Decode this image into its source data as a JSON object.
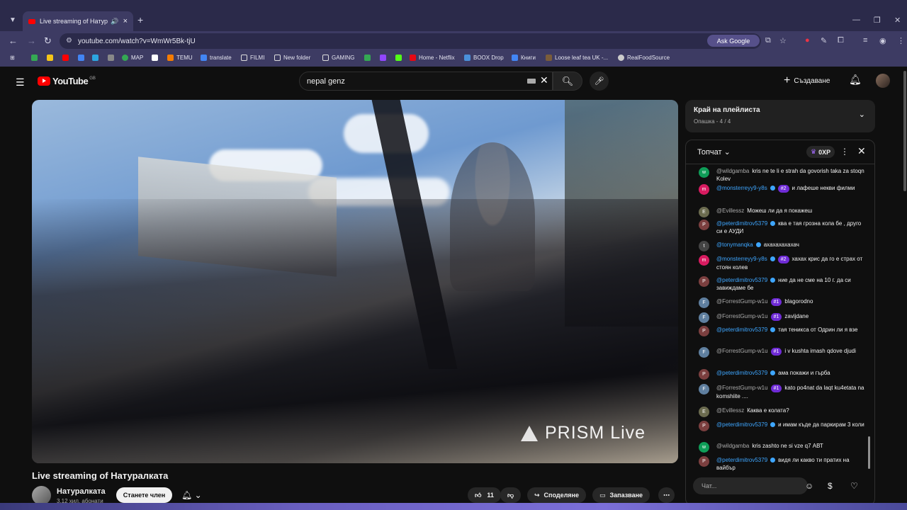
{
  "browser": {
    "tab_title": "Live streaming of Натуралка",
    "tab_audio": "🔊",
    "tab_close": "×",
    "new_tab": "+",
    "url": "youtube.com/watch?v=WmWr5Bk-tjU",
    "ask_google": "Ask Google",
    "bookmarks": [
      "MAP",
      "TEMU",
      "translate",
      "FILMI",
      "New folder",
      "GAMING",
      "Home - Netflix",
      "BOOX Drop",
      "Книги",
      "Loose leaf tea UK -...",
      "RealFoodSource"
    ]
  },
  "youtube": {
    "logo_text": "YouTube",
    "region": "GB",
    "search_value": "nepal genz",
    "create_label": "Създаване"
  },
  "video": {
    "title": "Live streaming of Натуралката",
    "overlay_brand": "PRISM",
    "overlay_live": "Live"
  },
  "channel": {
    "name": "Натуралката",
    "subs": "3,12 хил. абонати",
    "join_label": "Станете член"
  },
  "actions": {
    "likes": "11",
    "share": "Споделяне",
    "save": "Запазване"
  },
  "playlist": {
    "title": "Край на плейлиста",
    "subtitle": "Опашка - 4 / 4"
  },
  "chat": {
    "mode": "Топчат",
    "xp": "0XP",
    "input_placeholder": "Чат...",
    "messages": [
      {
        "author": "@wildgamba",
        "text": "kris ne te li e strah da govorish taka za stoqn Kolev",
        "badge": "",
        "member": false,
        "color": "#0f9d58",
        "init": "w"
      },
      {
        "author": "@monsterreyy9-y8s",
        "text": "и лафеше некви филми",
        "badge": "#2",
        "member": true,
        "color": "#d81b60",
        "init": "m"
      },
      {
        "author": "@Evillessz",
        "text": "Можеш ли да я покажеш",
        "badge": "",
        "member": false,
        "color": "#6b6b4f",
        "init": "E"
      },
      {
        "author": "@peterdimitrov5379",
        "text": "ква е тая грозна кола бе , друго си е АУДИ",
        "badge": "",
        "member": true,
        "color": "#7b3f3f",
        "init": "P"
      },
      {
        "author": "@tonymanqka",
        "text": "ахахахахахач",
        "badge": "",
        "member": true,
        "color": "#444",
        "init": "t"
      },
      {
        "author": "@monsterreyy9-y8s",
        "text": "хахах крис да го е страх от стоян колев",
        "badge": "#2",
        "member": true,
        "color": "#d81b60",
        "init": "m"
      },
      {
        "author": "@peterdimitrov5379",
        "text": "ние да не сме на 10 г. да си завиждаме бе",
        "badge": "",
        "member": true,
        "color": "#7b3f3f",
        "init": "P"
      },
      {
        "author": "@ForrestGump-w1u",
        "text": "blagorodno",
        "badge": "#1",
        "member": false,
        "color": "#5f7f9f",
        "init": "F"
      },
      {
        "author": "@ForrestGump-w1u",
        "text": "zavijdane",
        "badge": "#1",
        "member": false,
        "color": "#5f7f9f",
        "init": "F"
      },
      {
        "author": "@peterdimitrov5379",
        "text": "тая теникса от Одрин ли я взе",
        "badge": "",
        "member": true,
        "color": "#7b3f3f",
        "init": "P"
      },
      {
        "author": "@ForrestGump-w1u",
        "text": "i v kushta imash qdove djudi",
        "badge": "#1",
        "member": false,
        "color": "#5f7f9f",
        "init": "F"
      },
      {
        "author": "@peterdimitrov5379",
        "text": "ама покажи и гърба",
        "badge": "",
        "member": true,
        "color": "#7b3f3f",
        "init": "P"
      },
      {
        "author": "@ForrestGump-w1u",
        "text": "kato po4nat da laqt ku4etata na komshiite ....",
        "badge": "#1",
        "member": false,
        "color": "#5f7f9f",
        "init": "F"
      },
      {
        "author": "@Evillessz",
        "text": "Каква е колата?",
        "badge": "",
        "member": false,
        "color": "#6b6b4f",
        "init": "E"
      },
      {
        "author": "@peterdimitrov5379",
        "text": "и имам къде да паркирам 3 коли",
        "badge": "",
        "member": true,
        "color": "#7b3f3f",
        "init": "P"
      },
      {
        "author": "@wildgamba",
        "text": "kris zashto ne si vze q7 АВТ",
        "badge": "",
        "member": false,
        "color": "#0f9d58",
        "init": "w"
      },
      {
        "author": "@peterdimitrov5379",
        "text": "видя ли какво ти пратих на вайбър",
        "badge": "",
        "member": true,
        "color": "#7b3f3f",
        "init": "P"
      }
    ]
  }
}
